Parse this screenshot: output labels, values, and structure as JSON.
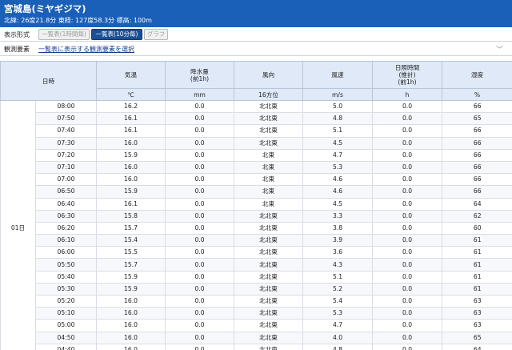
{
  "station": {
    "title": "宮城島(ミヤギジマ)",
    "coords": "北緯: 26度21.8分 東経: 127度58.3分 標高: 100m"
  },
  "display": {
    "label": "表示形式",
    "buttons": [
      "一覧表(1時間毎)",
      "一覧表(10分毎)",
      "グラフ"
    ],
    "active": 1
  },
  "elements": {
    "label": "観測要素",
    "link": "一覧表に表示する観測要素を選択"
  },
  "table": {
    "headers": {
      "datetime": "日時",
      "temp": "気温",
      "precip": [
        "降水量",
        "(前1h)"
      ],
      "wind_dir": "風向",
      "wind_speed": "風速",
      "sunshine": [
        "日照時間",
        "(推計)",
        "(前1h)"
      ],
      "humidity": "湿度"
    },
    "units": {
      "temp": "℃",
      "precip": "mm",
      "wind_dir": "16方位",
      "wind_speed": "m/s",
      "sunshine": "h",
      "humidity": "%"
    },
    "day": "01日",
    "rows": [
      [
        "08:00",
        "16.2",
        "0.0",
        "北北東",
        "5.0",
        "0.0",
        "66"
      ],
      [
        "07:50",
        "16.1",
        "0.0",
        "北北東",
        "4.8",
        "0.0",
        "65"
      ],
      [
        "07:40",
        "16.1",
        "0.0",
        "北北東",
        "5.1",
        "0.0",
        "66"
      ],
      [
        "07:30",
        "16.0",
        "0.0",
        "北北東",
        "4.5",
        "0.0",
        "66"
      ],
      [
        "07:20",
        "15.9",
        "0.0",
        "北東",
        "4.7",
        "0.0",
        "66"
      ],
      [
        "07:10",
        "16.0",
        "0.0",
        "北東",
        "5.3",
        "0.0",
        "66"
      ],
      [
        "07:00",
        "16.0",
        "0.0",
        "北東",
        "4.6",
        "0.0",
        "66"
      ],
      [
        "06:50",
        "15.9",
        "0.0",
        "北東",
        "4.6",
        "0.0",
        "66"
      ],
      [
        "06:40",
        "16.1",
        "0.0",
        "北東",
        "4.5",
        "0.0",
        "64"
      ],
      [
        "06:30",
        "15.8",
        "0.0",
        "北北東",
        "3.3",
        "0.0",
        "62"
      ],
      [
        "06:20",
        "15.7",
        "0.0",
        "北北東",
        "3.8",
        "0.0",
        "60"
      ],
      [
        "06:10",
        "15.4",
        "0.0",
        "北北東",
        "3.9",
        "0.0",
        "61"
      ],
      [
        "06:00",
        "15.5",
        "0.0",
        "北北東",
        "3.6",
        "0.0",
        "61"
      ],
      [
        "05:50",
        "15.7",
        "0.0",
        "北北東",
        "4.3",
        "0.0",
        "61"
      ],
      [
        "05:40",
        "15.9",
        "0.0",
        "北北東",
        "5.1",
        "0.0",
        "61"
      ],
      [
        "05:30",
        "15.9",
        "0.0",
        "北北東",
        "5.2",
        "0.0",
        "61"
      ],
      [
        "05:20",
        "16.0",
        "0.0",
        "北北東",
        "5.4",
        "0.0",
        "63"
      ],
      [
        "05:10",
        "16.0",
        "0.0",
        "北北東",
        "5.3",
        "0.0",
        "63"
      ],
      [
        "05:00",
        "16.0",
        "0.0",
        "北北東",
        "4.7",
        "0.0",
        "63"
      ],
      [
        "04:50",
        "16.0",
        "0.0",
        "北北東",
        "4.0",
        "0.0",
        "65"
      ],
      [
        "04:40",
        "16.0",
        "0.0",
        "北北東",
        "4.8",
        "0.0",
        "64"
      ]
    ]
  }
}
